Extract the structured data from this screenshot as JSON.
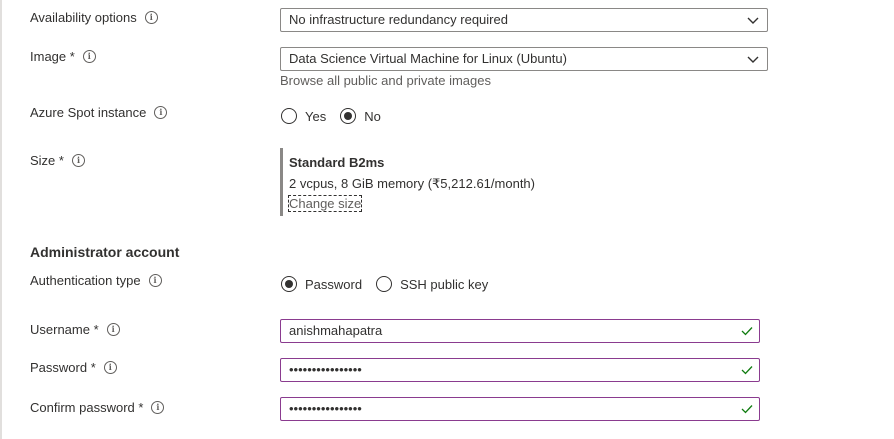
{
  "fields": {
    "availability": {
      "label": "Availability options",
      "value": "No infrastructure redundancy required"
    },
    "image": {
      "label": "Image *",
      "value": "Data Science Virtual Machine for Linux (Ubuntu)",
      "browse_link": "Browse all public and private images"
    },
    "spot": {
      "label": "Azure Spot instance",
      "options": [
        "Yes",
        "No"
      ],
      "selected": "No"
    },
    "size": {
      "label": "Size *",
      "name": "Standard B2ms",
      "description": "2 vcpus, 8 GiB memory (₹5,212.61/month)",
      "change_link": "Change size"
    }
  },
  "admin": {
    "heading": "Administrator account",
    "auth_type": {
      "label": "Authentication type",
      "options": [
        "Password",
        "SSH public key"
      ],
      "selected": "Password"
    },
    "username": {
      "label": "Username *",
      "value": "anishmahapatra"
    },
    "password": {
      "label": "Password *",
      "value": "••••••••••••••••"
    },
    "confirm_password": {
      "label": "Confirm password *",
      "value": "••••••••••••••••"
    }
  },
  "icons": {
    "info": "info-icon",
    "chevron": "chevron-down-icon",
    "check": "checkmark-icon"
  },
  "colors": {
    "valid_border": "#8a3b8f",
    "check_green": "#107c10",
    "text": "#323130",
    "muted": "#605e5c"
  }
}
